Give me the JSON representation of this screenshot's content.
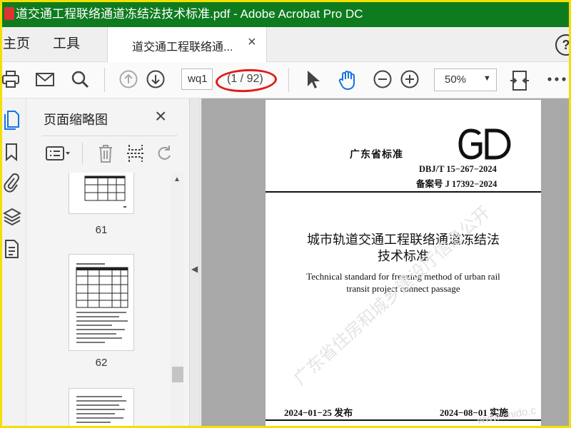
{
  "window": {
    "title": "道交通工程联络通道冻结法技术标准.pdf - Adobe Acrobat Pro DC",
    "overlay_text": "道交通"
  },
  "tabs": {
    "home": "主页",
    "tools": "工具",
    "document": "道交通工程联络通...",
    "close": "×",
    "help": "?"
  },
  "toolbar": {
    "page_input": "wq1",
    "page_count": "(1 / 92)",
    "zoom": "50%"
  },
  "thumbnail_panel": {
    "title": "页面缩略图",
    "close": "×",
    "pages": [
      "61",
      "62"
    ]
  },
  "document": {
    "standard_label": "广东省标准",
    "logo": "GD",
    "code": "DBJ/T 15−267−2024",
    "filing": "备案号  J 17392−2024",
    "title_line1": "城市轨道交通工程联络通道冻结法",
    "title_line2": "技术标准",
    "english_line1": "Technical standard for freezing method of urban rail",
    "english_line2": "transit project connect passage",
    "publish": "2024−01−25    发布",
    "implement": "2024−08−01    实施",
    "watermark": "广东省住房和城乡建设厅信息公开"
  },
  "site_watermark": "www.cnido.c",
  "colors": {
    "titlebar": "#0f7b1f",
    "frame": "#f4e000",
    "annotation": "#e21a1a",
    "accent_hand": "#1473e6"
  },
  "icons": [
    "printer-icon",
    "mail-icon",
    "search-icon",
    "prev-page-icon",
    "next-page-icon",
    "select-arrow-icon",
    "hand-icon",
    "zoom-out-icon",
    "zoom-in-icon",
    "fit-page-icon",
    "more-icon"
  ]
}
